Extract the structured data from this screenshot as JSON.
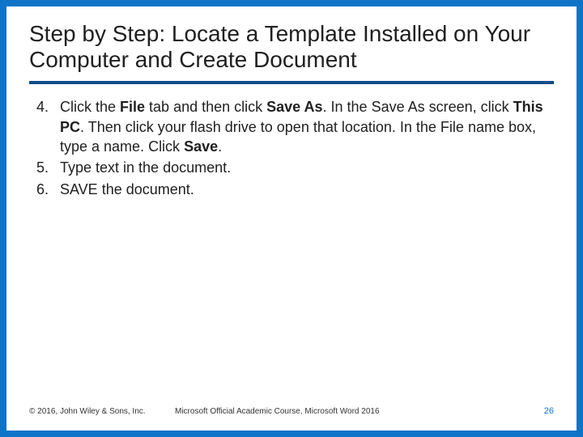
{
  "title": "Step by Step: Locate a Template Installed on Your Computer and Create Document",
  "steps": [
    {
      "num": "4.",
      "segments": [
        {
          "t": "Click the "
        },
        {
          "t": "File",
          "b": true
        },
        {
          "t": " tab and then click "
        },
        {
          "t": "Save As",
          "b": true
        },
        {
          "t": ". In the Save As screen, click "
        },
        {
          "t": "This PC",
          "b": true
        },
        {
          "t": ". Then click your flash drive to open that location. In the File name box, type a name. Click "
        },
        {
          "t": "Save",
          "b": true
        },
        {
          "t": "."
        }
      ]
    },
    {
      "num": "5.",
      "segments": [
        {
          "t": "Type text in the document."
        }
      ]
    },
    {
      "num": "6.",
      "segments": [
        {
          "t": "SAVE the document."
        }
      ]
    }
  ],
  "footer": {
    "copyright": "© 2016, John Wiley & Sons, Inc.",
    "course": "Microsoft Official Academic Course, Microsoft Word 2016",
    "pagenum": "26"
  }
}
